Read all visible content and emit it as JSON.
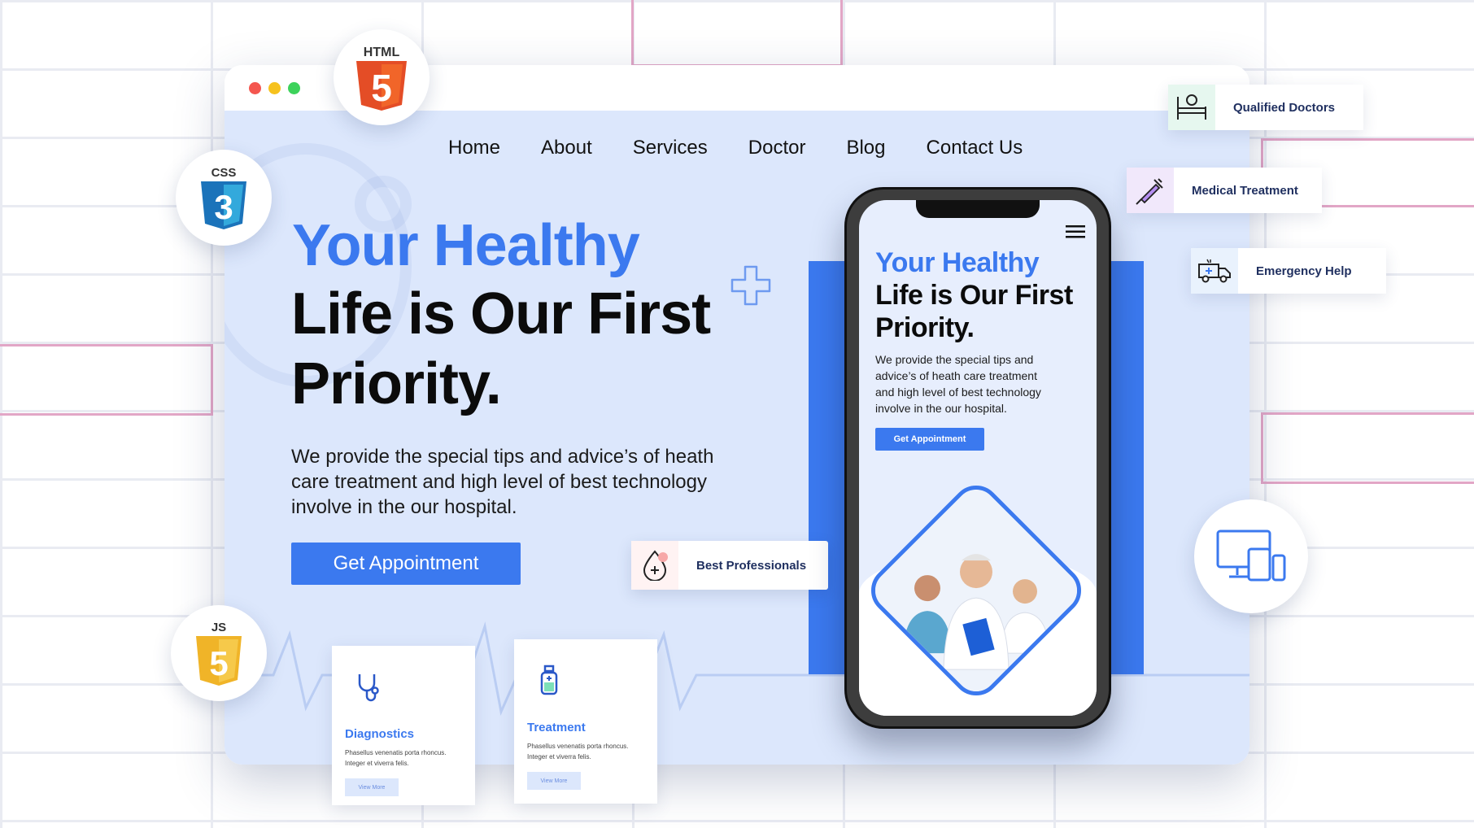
{
  "nav": {
    "items": [
      {
        "label": "Home"
      },
      {
        "label": "About"
      },
      {
        "label": "Services"
      },
      {
        "label": "Doctor"
      },
      {
        "label": "Blog"
      },
      {
        "label": "Contact Us"
      }
    ]
  },
  "hero": {
    "title_line1": "Your Healthy",
    "title_line2": "Life is Our First",
    "title_line3": "Priority.",
    "description": "We provide the special tips and advice’s of heath care treatment and high level of best technology involve in the our hospital.",
    "cta_label": "Get Appointment"
  },
  "phone": {
    "title_line1": "Your Healthy",
    "title_line2": "Life is Our First",
    "title_line3": "Priority.",
    "description": "We provide the special tips and advice’s of heath care treatment and high level of best technology involve in the our hospital.",
    "cta_label": "Get Appointment"
  },
  "best_professionals": {
    "label": "Best Professionals"
  },
  "service_cards": [
    {
      "title": "Diagnostics",
      "description": "Phasellus venenatis porta rhoncus. Integer et viverra felis.",
      "button": "View More",
      "icon": "stethoscope-icon"
    },
    {
      "title": "Treatment",
      "description": "Phasellus venenatis porta rhoncus. Integer et viverra felis.",
      "button": "View More",
      "icon": "medicine-bottle-icon"
    }
  ],
  "features": [
    {
      "label": "Qualified Doctors",
      "icon": "hospital-bed-icon"
    },
    {
      "label": "Medical Treatment",
      "icon": "syringe-icon"
    },
    {
      "label": "Emergency Help",
      "icon": "ambulance-icon"
    }
  ],
  "tech_badges": [
    {
      "label": "HTML",
      "number": "5",
      "icon": "html5-icon",
      "color": "#e44d26"
    },
    {
      "label": "CSS",
      "number": "3",
      "icon": "css3-icon",
      "color": "#1b73ba"
    },
    {
      "label": "JS",
      "number": "5",
      "icon": "js-icon",
      "color": "#f0b428"
    }
  ],
  "colors": {
    "accent": "#3b79ef",
    "page_bg": "#dce7fc",
    "heading_dark": "#0b0b0b"
  }
}
